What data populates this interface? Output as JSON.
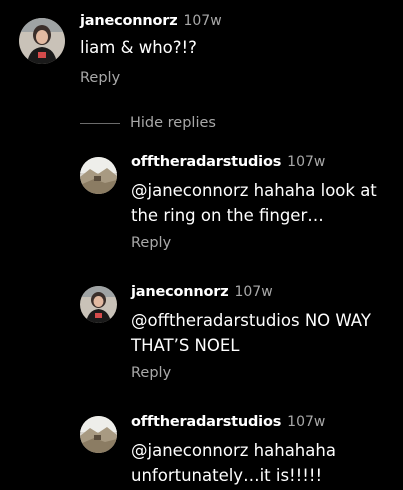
{
  "thread": {
    "main_comment": {
      "username": "janeconnorz",
      "time": "107w",
      "text": "liam & who?!?",
      "reply_label": "Reply"
    },
    "hide_replies_label": "Hide replies",
    "replies": [
      {
        "username": "offtheradarstudios",
        "time": "107w",
        "text_line1": "@janeconnorz hahaha look at",
        "text_line2": "the ring on the finger…",
        "reply_label": "Reply"
      },
      {
        "username": "janeconnorz",
        "time": "107w",
        "text_line1": "@offtheradarstudios NO WAY",
        "text_line2": "THAT’S NOEL",
        "reply_label": "Reply"
      },
      {
        "username": "offtheradarstudios",
        "time": "107w",
        "text_line1": "@janeconnorz hahahaha",
        "text_line2": "unfortunately…it is!!!!!"
      }
    ]
  },
  "icons": {
    "avatar_jane": "avatar-portrait",
    "avatar_studio": "avatar-landscape"
  }
}
